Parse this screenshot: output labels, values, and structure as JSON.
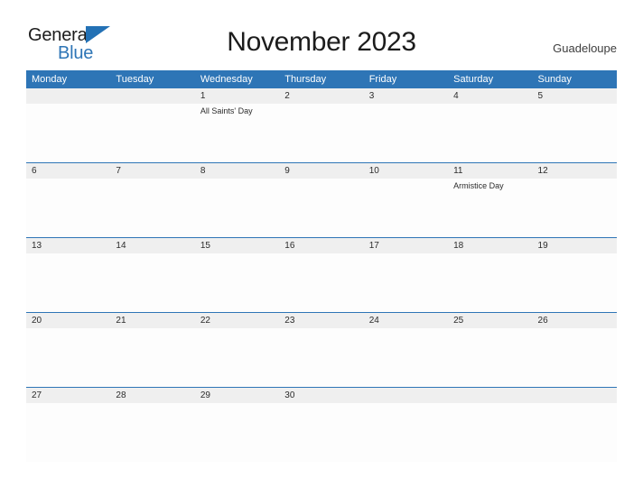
{
  "brand": {
    "name_top": "General",
    "name_bottom": "Blue",
    "flag_icon": "flag-triangle-icon",
    "color_primary": "#2e75b6",
    "color_text": "#1c1c1c"
  },
  "header": {
    "title": "November 2023",
    "location": "Guadeloupe"
  },
  "calendar": {
    "header_bg": "#2e75b6",
    "daynum_bg": "#efefef",
    "divider_color": "#2e75b6",
    "day_names": [
      "Monday",
      "Tuesday",
      "Wednesday",
      "Thursday",
      "Friday",
      "Saturday",
      "Sunday"
    ],
    "weeks": [
      {
        "days": [
          {
            "num": "",
            "event": ""
          },
          {
            "num": "",
            "event": ""
          },
          {
            "num": "1",
            "event": "All Saints' Day"
          },
          {
            "num": "2",
            "event": ""
          },
          {
            "num": "3",
            "event": ""
          },
          {
            "num": "4",
            "event": ""
          },
          {
            "num": "5",
            "event": ""
          }
        ]
      },
      {
        "days": [
          {
            "num": "6",
            "event": ""
          },
          {
            "num": "7",
            "event": ""
          },
          {
            "num": "8",
            "event": ""
          },
          {
            "num": "9",
            "event": ""
          },
          {
            "num": "10",
            "event": ""
          },
          {
            "num": "11",
            "event": "Armistice Day"
          },
          {
            "num": "12",
            "event": ""
          }
        ]
      },
      {
        "days": [
          {
            "num": "13",
            "event": ""
          },
          {
            "num": "14",
            "event": ""
          },
          {
            "num": "15",
            "event": ""
          },
          {
            "num": "16",
            "event": ""
          },
          {
            "num": "17",
            "event": ""
          },
          {
            "num": "18",
            "event": ""
          },
          {
            "num": "19",
            "event": ""
          }
        ]
      },
      {
        "days": [
          {
            "num": "20",
            "event": ""
          },
          {
            "num": "21",
            "event": ""
          },
          {
            "num": "22",
            "event": ""
          },
          {
            "num": "23",
            "event": ""
          },
          {
            "num": "24",
            "event": ""
          },
          {
            "num": "25",
            "event": ""
          },
          {
            "num": "26",
            "event": ""
          }
        ]
      },
      {
        "days": [
          {
            "num": "27",
            "event": ""
          },
          {
            "num": "28",
            "event": ""
          },
          {
            "num": "29",
            "event": ""
          },
          {
            "num": "30",
            "event": ""
          },
          {
            "num": "",
            "event": ""
          },
          {
            "num": "",
            "event": ""
          },
          {
            "num": "",
            "event": ""
          }
        ]
      }
    ]
  }
}
